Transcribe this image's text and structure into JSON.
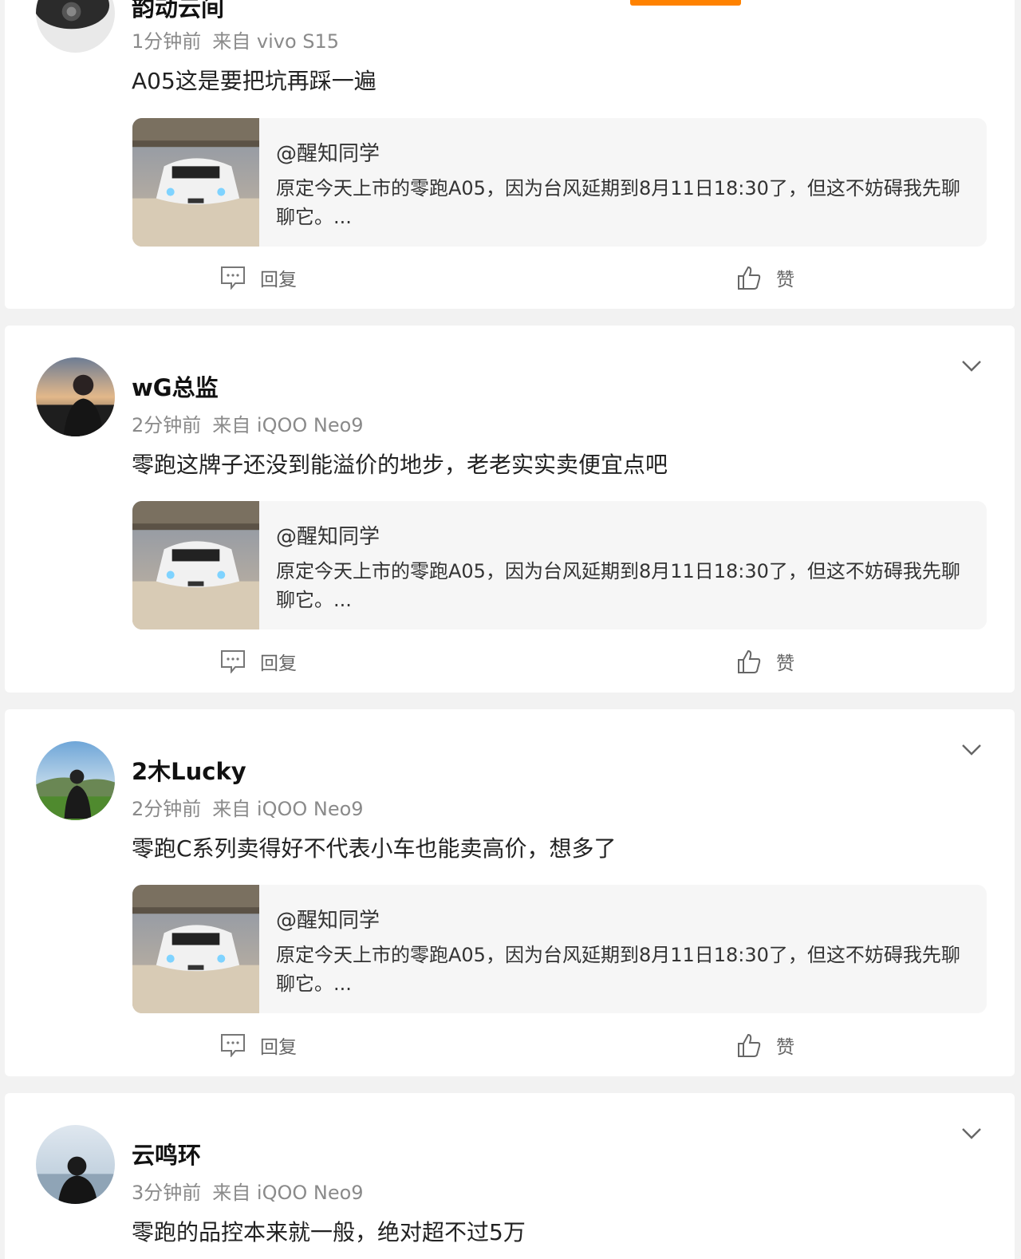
{
  "posts": [
    {
      "username": "韵动云间",
      "time": "1分钟前",
      "source": "来自 vivo S15",
      "text": "A05这是要把坑再踩一遍",
      "quote": {
        "author": "@醒知同学",
        "excerpt": "原定今天上市的零跑A05，因为台风延期到8月11日18:30了，但这不妨碍我先聊聊它。..."
      },
      "reply_label": "回复",
      "like_label": "赞"
    },
    {
      "username": "wG总监",
      "time": "2分钟前",
      "source": "来自 iQOO Neo9",
      "text": "零跑这牌子还没到能溢价的地步，老老实实卖便宜点吧",
      "quote": {
        "author": "@醒知同学",
        "excerpt": "原定今天上市的零跑A05，因为台风延期到8月11日18:30了，但这不妨碍我先聊聊它。..."
      },
      "reply_label": "回复",
      "like_label": "赞"
    },
    {
      "username": "2木Lucky",
      "time": "2分钟前",
      "source": "来自 iQOO Neo9",
      "text": "零跑C系列卖得好不代表小车也能卖高价，想多了",
      "quote": {
        "author": "@醒知同学",
        "excerpt": "原定今天上市的零跑A05，因为台风延期到8月11日18:30了，但这不妨碍我先聊聊它。..."
      },
      "reply_label": "回复",
      "like_label": "赞"
    },
    {
      "username": "云鸣环",
      "time": "3分钟前",
      "source": "来自 iQOO Neo9",
      "text": "零跑的品控本来就一般，绝对超不过5万"
    }
  ],
  "colors": {
    "accent": "#ff8200",
    "page_bg": "#f2f2f2",
    "card_bg": "#ffffff",
    "quote_bg": "#f6f6f6",
    "meta": "#8a8a8a"
  },
  "icons": {
    "reply": "comment-icon",
    "like": "thumbs-up-icon",
    "more": "chevron-down-icon"
  }
}
